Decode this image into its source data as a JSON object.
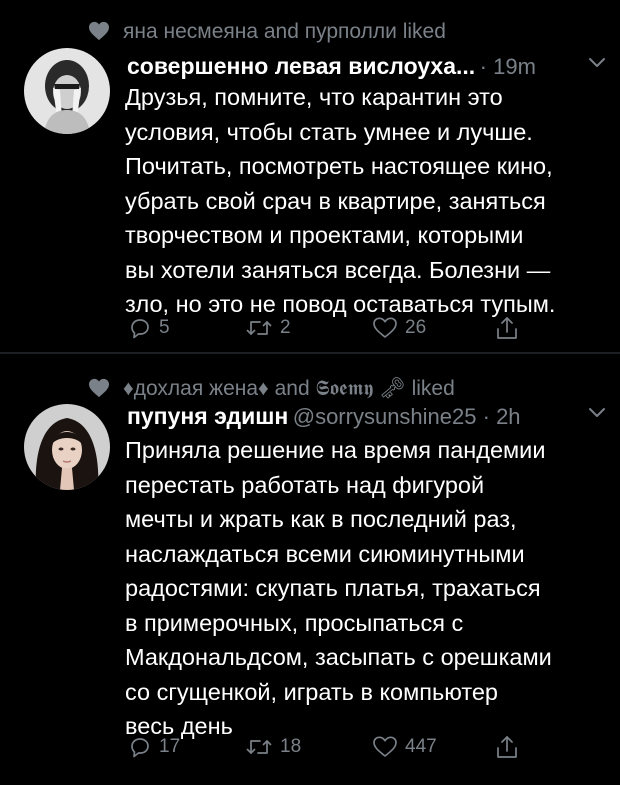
{
  "tweets": [
    {
      "social_context": "яна несмеяна and пурполли liked",
      "display_name": "совершенно левая вислоуха...",
      "handle": "",
      "time": "19m",
      "text_lines": [
        "Друзья, помните, что карантин это",
        "условия, чтобы стать умнее и лучше.",
        "Почитать, посмотреть настоящее кино,",
        "убрать свой срач в квартире, заняться",
        "творчеством и проектами, которыми",
        "вы хотели заняться всегда. Болезни —",
        "зло, но это не повод оставаться тупым."
      ],
      "replies": "5",
      "retweets": "2",
      "likes": "26",
      "icons": [
        "heart-icon",
        "chevron-down-icon",
        "reply-icon",
        "retweet-icon",
        "like-icon",
        "share-icon"
      ]
    },
    {
      "social_context": "♦дохлая жена♦ and 𝕾𝖔𝖊𝖒𝖞 🗝 liked",
      "display_name": "пупуня эдишн",
      "handle": "@sorrysunshine25",
      "time": "2h",
      "text_lines": [
        "Приняла решение на время пандемии",
        "перестать работать над фигурой",
        "мечты и жрать как в последний раз,",
        "наслаждаться всеми сиюминутными",
        "радостями: скупать платья, трахаться",
        "в примерочных, просыпаться с",
        "Макдональдсом, засыпать с орешками",
        "со сгущенкой, играть в компьютер",
        "весь день"
      ],
      "replies": "17",
      "retweets": "18",
      "likes": "447",
      "icons": [
        "heart-icon",
        "chevron-down-icon",
        "reply-icon",
        "retweet-icon",
        "like-icon",
        "share-icon"
      ]
    }
  ],
  "colors": {
    "background": "#000000",
    "text": "#ffffff",
    "muted": "#7a8188",
    "divider": "#1c1f23"
  }
}
